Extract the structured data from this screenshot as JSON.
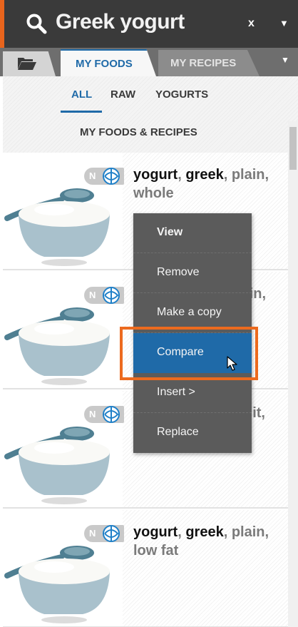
{
  "search": {
    "query": "Greek yogurt",
    "clear_label": "x",
    "menu_glyph": "▼"
  },
  "tabs": {
    "folder_icon": "folder-open-icon",
    "items": [
      {
        "label": "MY FOODS",
        "active": true
      },
      {
        "label": "MY RECIPES",
        "active": false
      }
    ],
    "menu_glyph": "▼"
  },
  "filters": {
    "items": [
      "ALL",
      "RAW",
      "YOGURTS"
    ],
    "active": "ALL",
    "second_row": "MY FOODS & RECIPES"
  },
  "foods": [
    {
      "bold_1": "yogurt",
      "sep_1": ", ",
      "bold_2": "greek",
      "rest": ", plain, whole",
      "badge_letter": "N"
    },
    {
      "bold_1": "",
      "sep_1": "",
      "bold_2": "",
      "rest": "lain,",
      "badge_letter": "N"
    },
    {
      "bold_1": "",
      "sep_1": "",
      "bold_2": "",
      "rest": "uit,",
      "badge_letter": "N"
    },
    {
      "bold_1": "yogurt",
      "sep_1": ", ",
      "bold_2": "greek",
      "rest": ", plain, low fat",
      "badge_letter": "N"
    }
  ],
  "context_menu": {
    "items": [
      "View",
      "Remove",
      "Make a copy",
      "Compare",
      "Insert >",
      "Replace"
    ],
    "highlighted": "Compare"
  },
  "colors": {
    "accent_orange": "#ec6a1e",
    "brand_blue": "#1f6aa8",
    "header_dark": "#3a3a3a",
    "menu_gray": "#5b5b5b"
  }
}
